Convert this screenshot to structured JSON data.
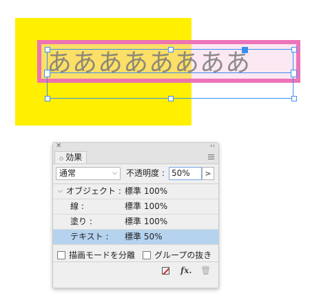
{
  "canvas": {
    "sample_text": "ああああああああ",
    "colors": {
      "fill": "#FFEF00",
      "frame": "#EC6EB5",
      "selection": "#3B8DF0"
    }
  },
  "panel": {
    "tab_label": "効果",
    "blend_mode": "通常",
    "opacity_label": "不透明度 :",
    "opacity_value": "50%",
    "rows": [
      {
        "label": "オブジェクト :",
        "value": "標準 100%"
      },
      {
        "label": "線 :",
        "value": "標準 100%"
      },
      {
        "label": "塗り :",
        "value": "標準 100%"
      },
      {
        "label": "テキスト :",
        "value": "標準 50%",
        "selected": true
      }
    ],
    "checkbox_knockout": "描画モードを分離",
    "checkbox_group": "グループの抜き",
    "fx_label": "fx."
  }
}
